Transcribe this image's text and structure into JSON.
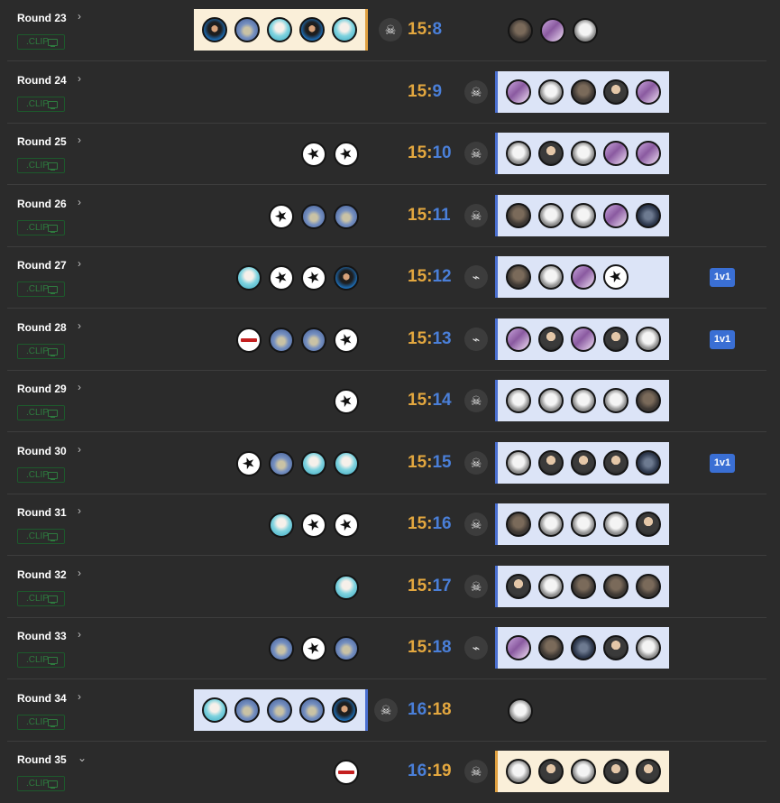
{
  "colors": {
    "background": "#2b2b2b",
    "t_side": "#e3a73f",
    "ct_side": "#4a7fd8",
    "ct_box": "#dce4f7",
    "t_box": "#faefd9",
    "clip_green": "#2e7a3e",
    "badge_blue": "#3a6fd4"
  },
  "clip_label": ".CLIP",
  "rounds": [
    {
      "label": "Round 23",
      "chevron": "›",
      "score_left": "15",
      "score_right": "8",
      "icon": "skull-icon",
      "left": [
        "blueface",
        "blue",
        "cyan",
        "blueface",
        "cyan"
      ],
      "right": [
        "gray",
        "pink",
        "white"
      ],
      "badge": ""
    },
    {
      "label": "Round 24",
      "chevron": "›",
      "score_left": "15",
      "score_right": "9",
      "icon": "skull-icon",
      "left": [],
      "right": [
        "pink",
        "white",
        "gray",
        "face",
        "pink"
      ],
      "badge": ""
    },
    {
      "label": "Round 25",
      "chevron": "›",
      "score_left": "15",
      "score_right": "10",
      "icon": "skull-icon",
      "left": [
        "star",
        "star"
      ],
      "right": [
        "white",
        "face",
        "white",
        "pink",
        "pink"
      ],
      "badge": ""
    },
    {
      "label": "Round 26",
      "chevron": "›",
      "score_left": "15",
      "score_right": "11",
      "icon": "skull-icon",
      "left": [
        "star",
        "blue",
        "blue"
      ],
      "right": [
        "gray",
        "white",
        "white",
        "pink",
        "dark"
      ],
      "badge": ""
    },
    {
      "label": "Round 27",
      "chevron": "›",
      "score_left": "15",
      "score_right": "12",
      "icon": "defuse-icon",
      "left": [
        "cyan",
        "star",
        "star",
        "blueface"
      ],
      "right": [
        "gray",
        "white",
        "pink",
        "star"
      ],
      "badge": "1v1"
    },
    {
      "label": "Round 28",
      "chevron": "›",
      "score_left": "15",
      "score_right": "13",
      "icon": "defuse-icon",
      "left": [
        "logo",
        "blue",
        "blue",
        "star"
      ],
      "right": [
        "pink",
        "face",
        "pink",
        "face",
        "white"
      ],
      "badge": "1v1"
    },
    {
      "label": "Round 29",
      "chevron": "›",
      "score_left": "15",
      "score_right": "14",
      "icon": "skull-icon",
      "left": [
        "star"
      ],
      "right": [
        "white",
        "white",
        "white",
        "white",
        "gray"
      ],
      "badge": ""
    },
    {
      "label": "Round 30",
      "chevron": "›",
      "score_left": "15",
      "score_right": "15",
      "icon": "skull-icon",
      "left": [
        "star",
        "blue",
        "cyan",
        "cyan"
      ],
      "right": [
        "white",
        "face",
        "face",
        "face",
        "dark"
      ],
      "badge": "1v1"
    },
    {
      "label": "Round 31",
      "chevron": "›",
      "score_left": "15",
      "score_right": "16",
      "icon": "skull-icon",
      "left": [
        "cyan",
        "star",
        "star"
      ],
      "right": [
        "gray",
        "white",
        "white",
        "white",
        "face"
      ],
      "badge": ""
    },
    {
      "label": "Round 32",
      "chevron": "›",
      "score_left": "15",
      "score_right": "17",
      "icon": "skull-icon",
      "left": [
        "cyan"
      ],
      "right": [
        "face",
        "white",
        "gray",
        "gray",
        "gray"
      ],
      "badge": ""
    },
    {
      "label": "Round 33",
      "chevron": "›",
      "score_left": "15",
      "score_right": "18",
      "icon": "defuse-icon",
      "left": [
        "blue",
        "star",
        "blue"
      ],
      "right": [
        "pink",
        "gray",
        "dark",
        "face",
        "white"
      ],
      "badge": ""
    },
    {
      "label": "Round 34",
      "chevron": "›",
      "score_left": "16",
      "score_right": "18",
      "icon": "skull-icon",
      "left": [
        "cyan",
        "blue",
        "blue",
        "blue",
        "blueface"
      ],
      "right": [
        "white"
      ],
      "badge": ""
    },
    {
      "label": "Round 35",
      "chevron": "⌄",
      "score_left": "16",
      "score_right": "19",
      "icon": "skull-icon",
      "left": [
        "logo"
      ],
      "right": [
        "white",
        "face",
        "white",
        "face",
        "face"
      ],
      "badge": ""
    }
  ]
}
